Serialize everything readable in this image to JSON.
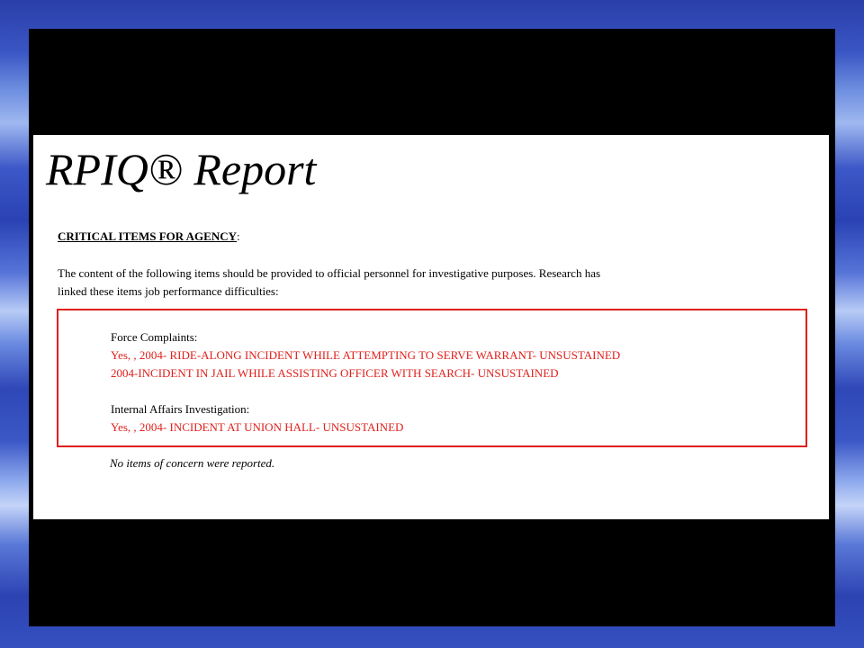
{
  "report": {
    "title": "RPIQ® Report",
    "section_heading": "CRITICAL ITEMS FOR AGENCY",
    "section_heading_suffix": ":",
    "intro_line_1": "The content of the following items should be provided to official personnel for investigative purposes. Research has",
    "intro_line_2": "linked these items job performance difficulties:",
    "force_complaints": {
      "label": "Force Complaints:",
      "details": [
        "Yes, , 2004- RIDE-ALONG INCIDENT WHILE ATTEMPTING TO SERVE WARRANT- UNSUSTAINED",
        "2004-INCIDENT IN JAIL WHILE ASSISTING OFFICER WITH SEARCH- UNSUSTAINED"
      ]
    },
    "internal_affairs": {
      "label": "Internal Affairs Investigation:",
      "details": [
        "Yes, , 2004- INCIDENT AT UNION HALL- UNSUSTAINED"
      ]
    },
    "footer_note": "No items of concern were reported."
  },
  "colors": {
    "highlight_red": "#e0201c",
    "frame_black": "#000000",
    "background_blue": "#3a56c4"
  }
}
